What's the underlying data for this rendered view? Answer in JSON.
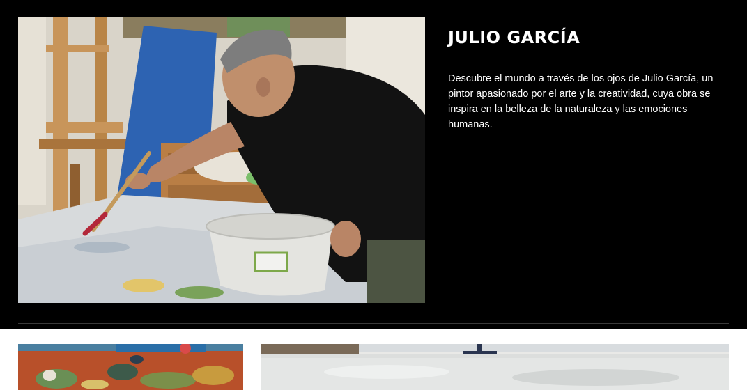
{
  "artist": {
    "name": "JULIO GARCÍA",
    "description": "Descubre el mundo a través de los ojos de Julio García, un pintor apasionado por el arte y la creatividad, cuya obra se inspira en la belleza de la naturaleza y las emociones humanas."
  },
  "images": {
    "hero": "painter-at-work-photo",
    "thumbnails": [
      "abstract-floral-painting",
      "white-textured-canvas"
    ]
  },
  "colors": {
    "background_dark": "#000000",
    "text": "#ffffff",
    "background_light": "#ffffff"
  }
}
